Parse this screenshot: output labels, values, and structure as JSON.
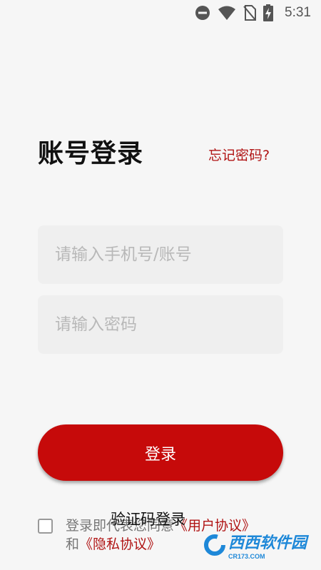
{
  "status_bar": {
    "time": "5:31",
    "icons": [
      "do-not-disturb-icon",
      "wifi-icon",
      "no-sim-icon",
      "battery-charging-icon"
    ]
  },
  "login": {
    "title": "账号登录",
    "forgot_password": "忘记密码?",
    "phone_placeholder": "请输入手机号/账号",
    "password_placeholder": "请输入密码",
    "login_button": "登录",
    "code_login": "验证码登录",
    "agreement_prefix": "登录即代表您同意",
    "user_agreement": "《用户协议》",
    "agreement_and": "和",
    "privacy_policy": "《隐私协议》"
  },
  "watermark": {
    "brand": "西西软件园",
    "domain": "CR173.COM"
  },
  "colors": {
    "accent": "#c60a0a",
    "link": "#b01414",
    "background": "#f6f6f6",
    "field_bg": "#efefef"
  }
}
